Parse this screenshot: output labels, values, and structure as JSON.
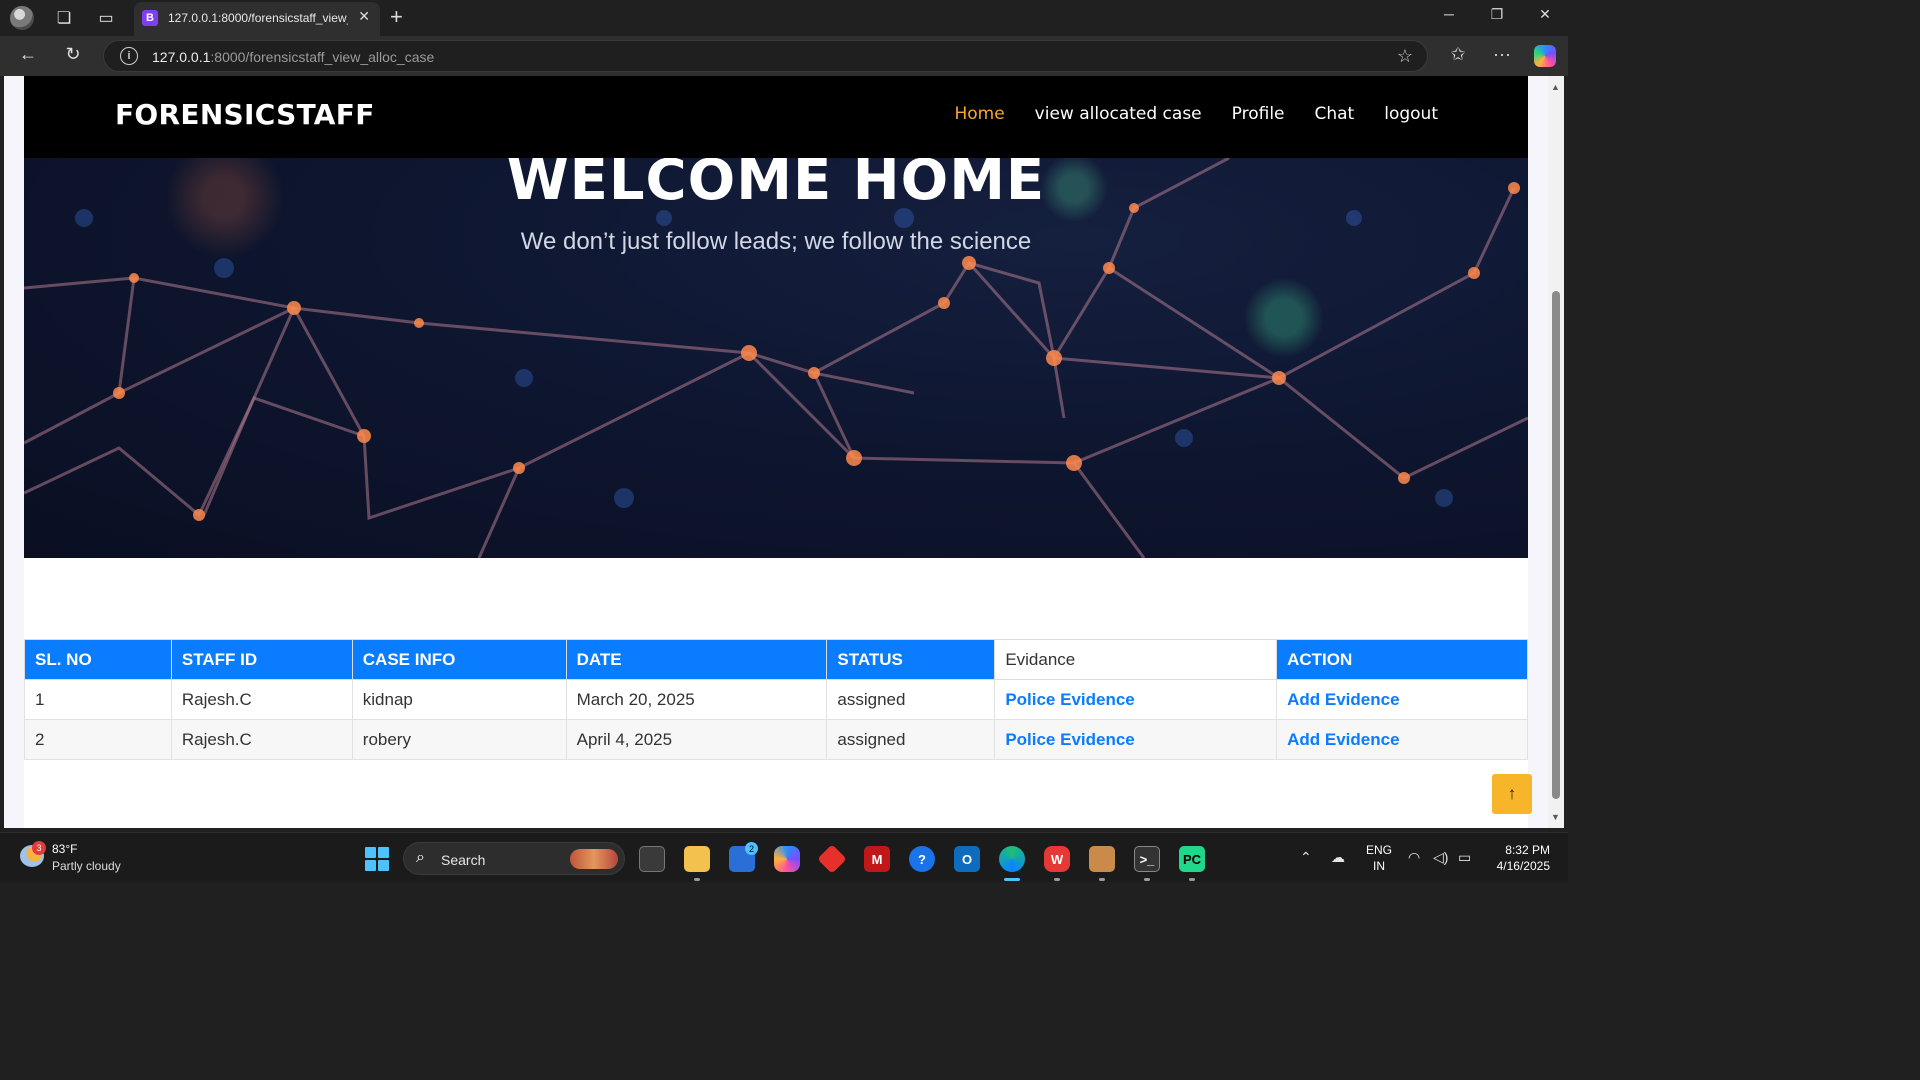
{
  "browser": {
    "tab_favicon": "B",
    "tab_title": "127.0.0.1:8000/forensicstaff_view_alloc_case",
    "url_host": "127.0.0.1",
    "url_rest": ":8000/forensicstaff_view_alloc_case"
  },
  "site": {
    "brand": "FORENSICSTAFF",
    "nav": {
      "home": "Home",
      "view_allocated_case": "view allocated case",
      "profile": "Profile",
      "chat": "Chat",
      "logout": "logout"
    },
    "hero_title": "WELCOME HOME",
    "hero_subtitle": "We don’t just follow leads; we follow the science"
  },
  "table": {
    "headers": {
      "sl_no": "SL. NO",
      "staff_id": "STAFF ID",
      "case_info": "CASE INFO",
      "date": "DATE",
      "status": "STATUS",
      "evidence": "Evidance",
      "action": "ACTION"
    },
    "rows": [
      {
        "sl": "1",
        "staff": "Rajesh.C",
        "case": "kidnap",
        "date": "March 20, 2025",
        "status": "assigned",
        "evidence": "Police Evidence",
        "action": "Add Evidence"
      },
      {
        "sl": "2",
        "staff": "Rajesh.C",
        "case": "robery",
        "date": "April 4, 2025",
        "status": "assigned",
        "evidence": "Police Evidence",
        "action": "Add Evidence"
      }
    ]
  },
  "taskbar": {
    "weather_temp": "83°F",
    "weather_desc": "Partly cloudy",
    "weather_badge": "3",
    "search_label": "Search",
    "store_badge": "2",
    "lang_top": "ENG",
    "lang_bottom": "IN",
    "time": "8:32 PM",
    "date": "4/16/2025"
  },
  "colors": {
    "accent_blue": "#0a7cff",
    "nav_active": "#f7a928",
    "back_to_top": "#f7b529"
  }
}
